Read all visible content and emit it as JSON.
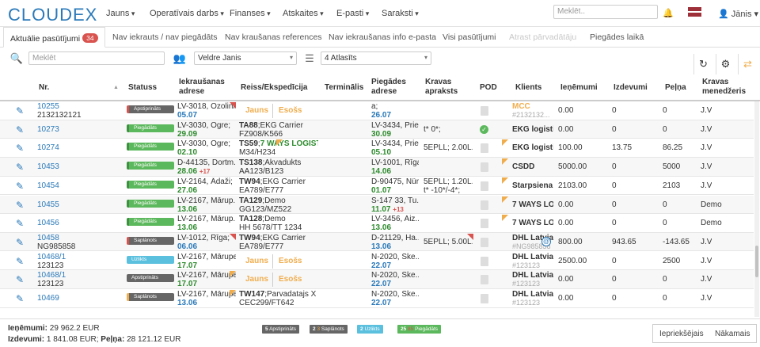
{
  "nav": {
    "logo": "CLOUDEX",
    "menus": [
      "Jauns",
      "Operatīvais darbs",
      "Finanses",
      "Atskaites",
      "E-pasti",
      "Saraksti"
    ],
    "search_placeholder": "Meklēt..",
    "user": "Jānis"
  },
  "tabs": {
    "items": [
      {
        "label": "Aktuālie pasūtījumi",
        "count": "34",
        "state": "active"
      },
      {
        "label": "Nav iekrauts / nav piegādāts",
        "state": "normal"
      },
      {
        "label": "Nav kraušanas references",
        "state": "normal"
      },
      {
        "label": "Nav iekraušanas info e-pasta",
        "state": "normal"
      },
      {
        "label": "Visi pasūtījumi",
        "state": "normal"
      },
      {
        "label": "Atrast pārvadātāju",
        "state": "disabled"
      },
      {
        "label": "Piegādes laikā",
        "state": "normal"
      }
    ]
  },
  "filters": {
    "search_placeholder": "Meklēt",
    "manager": "Veldre Janis",
    "status_selected": "4 Atlasīts"
  },
  "columns": [
    "Nr.",
    "Statuss",
    "Iekraušanas adrese",
    "Reiss/Ekspedīcija",
    "Terminālis",
    "Piegādes adrese",
    "Kravas apraksts",
    "POD",
    "Klients",
    "Ieņēmumi",
    "Izdevumi",
    "Peļņa",
    "Kravas menedžeris"
  ],
  "colors": {
    "accent": "#2a79b9",
    "green": "#5cb85c",
    "red": "#d9534f",
    "orange": "#f0ad4e",
    "info": "#5bc0de"
  },
  "rows": [
    {
      "nr": "10255",
      "sub": "2132132121",
      "status": "Apstiprināts",
      "sc": "b-gray",
      "load1": "LV-3018, Ozolini...",
      "load2": "05.07",
      "l2c": "dblue",
      "load2x": "",
      "reiss": "",
      "reiss2": "",
      "pill1": "Jauns",
      "pill2": "Esošs",
      "del1": "a;",
      "del2": "26.07",
      "d2c": "dblue",
      "del2x": "",
      "cargo": "",
      "pod": "doc",
      "client": "MCC",
      "client2": "#2132132...",
      "cc": "orange",
      "inc": "0.00",
      "exp": "0",
      "prof": "0",
      "mgr": "J.V",
      "tri": false
    },
    {
      "nr": "10273",
      "sub": "",
      "status": "Piegādāts",
      "sc": "b-green",
      "load1": "LV-3030, Ogre;",
      "load2": "29.09",
      "l2c": "dgreen",
      "load2x": "",
      "reiss": "TA88;EKG Carrier",
      "reiss2": "FZ908/K566",
      "pill1": "",
      "pill2": "",
      "del1": "LV-3434, Prie...",
      "del2": "30.09",
      "d2c": "dgreen",
      "del2x": "",
      "cargo": "t* 0*;",
      "pod": "ok",
      "client": "EKG logisti...",
      "client2": "",
      "cc": "",
      "inc": "0.00",
      "exp": "0",
      "prof": "0",
      "mgr": "J.V",
      "tri": false
    },
    {
      "nr": "10274",
      "sub": "",
      "status": "Piegādāts",
      "sc": "b-green",
      "load1": "LV-3030, Ogre;",
      "load2": "02.10",
      "l2c": "dgreen",
      "load2x": "",
      "reiss": "TS59;7 WAYS LOGIST...",
      "reiss2": "M34/H234",
      "pill1": "",
      "pill2": "",
      "del1": "LV-3434, Prie...",
      "del2": "05.10",
      "d2c": "dgreen",
      "del2x": "",
      "cargo": "5EPLL; 2.00L...",
      "pod": "doc",
      "client": "EKG logisti...",
      "client2": "",
      "cc": "",
      "inc": "100.00",
      "exp": "13.75",
      "prof": "86.25",
      "mgr": "J.V",
      "tri": true
    },
    {
      "nr": "10453",
      "sub": "",
      "status": "Piegādāts",
      "sc": "b-green",
      "load1": "D-44135, Dortm...",
      "load2": "28.06",
      "l2c": "dgreen",
      "load2x": "+17",
      "reiss": "TS138;Akvadukts",
      "reiss2": "AA123/B123",
      "pill1": "",
      "pill2": "",
      "del1": "LV-1001, Rīga;",
      "del2": "14.06",
      "d2c": "dgreen",
      "del2x": "",
      "cargo": "",
      "pod": "doc",
      "client": "CSDD",
      "client2": "",
      "cc": "",
      "inc": "5000.00",
      "exp": "0",
      "prof": "5000",
      "mgr": "J.V",
      "tri": true
    },
    {
      "nr": "10454",
      "sub": "",
      "status": "Piegādāts",
      "sc": "b-green",
      "load1": "LV-2164, Ādaži;",
      "load2": "27.06",
      "l2c": "dgreen",
      "load2x": "",
      "reiss": "TW94;EKG Carrier",
      "reiss2": "EA789/E777",
      "pill1": "",
      "pill2": "",
      "del1": "D-90475, Nür...",
      "del2": "01.07",
      "d2c": "dgreen",
      "del2x": "",
      "cargo": "5EPLL; 1.20L...",
      "cargo2": "t* -10*/-4*;",
      "pod": "doc",
      "client": "Starpsiena",
      "client2": "",
      "cc": "",
      "inc": "2103.00",
      "exp": "0",
      "prof": "2103",
      "mgr": "J.V",
      "tri": true
    },
    {
      "nr": "10455",
      "sub": "",
      "status": "Piegādāts",
      "sc": "b-green",
      "load1": "LV-2167, Mārup...",
      "load2": "13.06",
      "l2c": "dgreen",
      "load2x": "",
      "reiss": "TA129;Demo",
      "reiss2": "GG123/MZ522",
      "pill1": "",
      "pill2": "",
      "del1": "S-147 33, Tu...",
      "del2": "11.07",
      "d2c": "dgreen",
      "del2x": "+13",
      "cargo": "",
      "pod": "doc",
      "client": "7 WAYS LO...",
      "client2": "",
      "cc": "",
      "inc": "0.00",
      "exp": "0",
      "prof": "0",
      "mgr": "Demo",
      "tri": true
    },
    {
      "nr": "10456",
      "sub": "",
      "status": "Piegādāts",
      "sc": "b-green",
      "load1": "LV-2167, Mārup...",
      "load2": "13.06",
      "l2c": "dgreen",
      "load2x": "",
      "reiss": "TA128;Demo",
      "reiss2": "HH 5678/TT 1234",
      "pill1": "",
      "pill2": "",
      "del1": "LV-3456, Aiz...",
      "del2": "13.06",
      "d2c": "dgreen",
      "del2x": "",
      "cargo": "",
      "pod": "doc",
      "client": "7 WAYS LO...",
      "client2": "",
      "cc": "",
      "inc": "0.00",
      "exp": "0",
      "prof": "0",
      "mgr": "Demo",
      "tri": true
    },
    {
      "nr": "10458",
      "sub": "NG985858",
      "status": "Saplānots",
      "sc": "b-gray",
      "load1": "LV-1012, Rīga;",
      "load2": "06.06",
      "l2c": "dblue",
      "load2x": "",
      "reiss": "TW94;EKG Carrier",
      "reiss2": "EA789/E777",
      "pill1": "",
      "pill2": "",
      "del1": "D-21129, Ha...",
      "del2": "13.06",
      "d2c": "dblue",
      "del2x": "",
      "cargo": "5EPLL; 5.00L...",
      "pod": "doc",
      "client": "DHL Latvia",
      "client2": "#NG985858",
      "cc": "",
      "inc": "800.00",
      "exp": "943.65",
      "prof": "-143.65",
      "mgr": "J.V",
      "tri": false
    },
    {
      "nr": "10468/1",
      "sub": "123123",
      "status": "Uzlikts",
      "sc": "b-blue",
      "load1": "LV-2167, Mārupe;",
      "load2": "17.07",
      "l2c": "dgreen",
      "load2x": "",
      "reiss": "",
      "reiss2": "",
      "pill1": "Jauns",
      "pill2": "Esošs",
      "del1": "N-2020, Ske...",
      "del2": "22.07",
      "d2c": "dblue",
      "del2x": "",
      "cargo": "",
      "pod": "doc",
      "client": "DHL Latvia",
      "client2": "#123123",
      "cc": "",
      "inc": "2500.00",
      "exp": "0",
      "prof": "2500",
      "mgr": "J.V",
      "tri": false
    },
    {
      "nr": "10468/1",
      "sub": "123123",
      "status": "Apstiprināts",
      "sc": "b-gray2",
      "load1": "LV-2167, Mārupe;",
      "load2": "17.07",
      "l2c": "dgreen",
      "load2x": "",
      "reiss": "",
      "reiss2": "",
      "pill1": "Jauns",
      "pill2": "Esošs",
      "del1": "N-2020, Ske...",
      "del2": "22.07",
      "d2c": "dblue",
      "del2x": "",
      "cargo": "",
      "pod": "doc",
      "client": "DHL Latvia",
      "client2": "#123123",
      "cc": "",
      "inc": "0.00",
      "exp": "0",
      "prof": "0",
      "mgr": "J.V",
      "tri": false
    },
    {
      "nr": "10469",
      "sub": "",
      "status": "Saplānots",
      "sc": "b-gray3",
      "load1": "LV-2167, Mārupe;",
      "load2": "13.06",
      "l2c": "dblue",
      "load2x": "",
      "reiss": "TW147;Parvadatajs X",
      "reiss2": "CEC299/FT642",
      "pill1": "",
      "pill2": "",
      "del1": "N-2020, Ske...",
      "del2": "22.07",
      "d2c": "dblue",
      "del2x": "",
      "cargo": "",
      "pod": "doc",
      "client": "DHL Latvia",
      "client2": "#123123",
      "cc": "",
      "inc": "0.00",
      "exp": "0",
      "prof": "0",
      "mgr": "J.V",
      "tri": false
    }
  ],
  "footer": {
    "income_label": "Ieņēmumi:",
    "income": "29 962.2 EUR",
    "expenses_label": "Izdevumi:",
    "expenses": "1 841.08 EUR;",
    "profit_label": "Peļņa:",
    "profit": "28 121.12 EUR",
    "badges": [
      {
        "count": "5",
        "extra": "",
        "label": "Apstiprināts",
        "color": "#666"
      },
      {
        "count": "2",
        "extra": "3",
        "label": "Saplānots",
        "color": "#666"
      },
      {
        "count": "2",
        "extra": "",
        "label": "Uzlikts",
        "color": "#5bc0de"
      },
      {
        "count": "25",
        "extra": "85",
        "label": "Piegādāts",
        "color": "#5cb85c"
      }
    ],
    "prev": "Iepriekšējais",
    "next": "Nākamais"
  }
}
